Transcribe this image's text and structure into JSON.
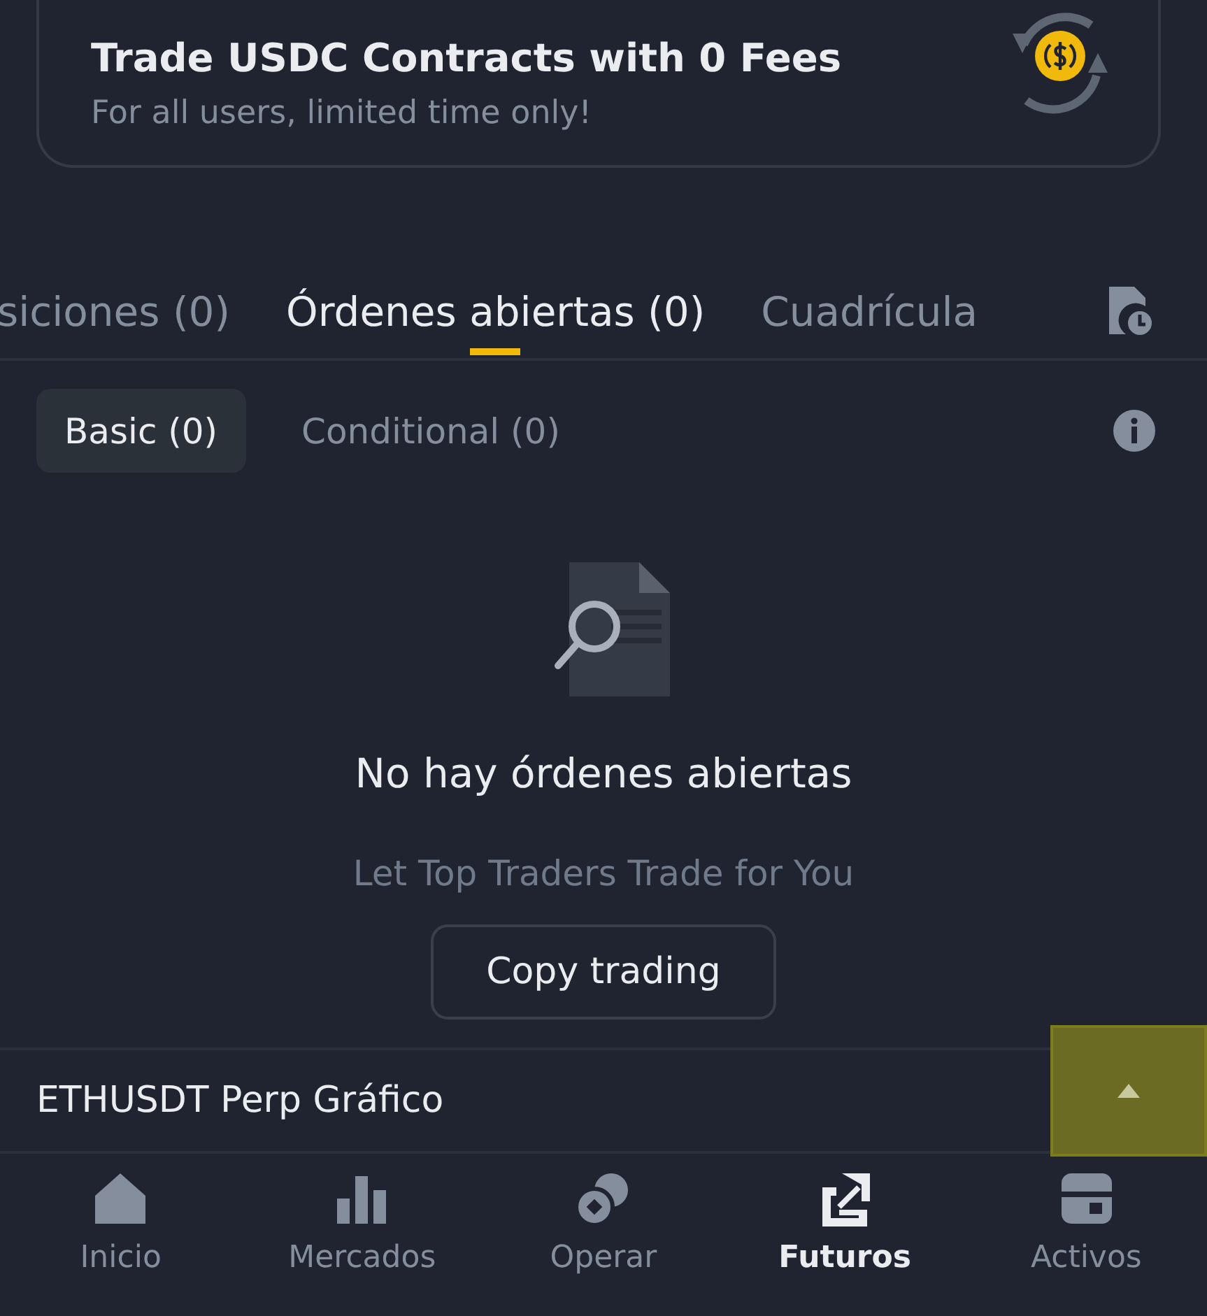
{
  "promo": {
    "title": "Trade USDC Contracts with 0 Fees",
    "subtitle": "For all users, limited time only!"
  },
  "tabs": [
    {
      "label": "siciones (0)",
      "selected": false
    },
    {
      "label": "Órdenes abiertas (0)",
      "selected": true
    },
    {
      "label": "Cuadrícula",
      "selected": false
    }
  ],
  "subtabs": [
    {
      "label": "Basic (0)",
      "selected": true
    },
    {
      "label": "Conditional (0)",
      "selected": false
    }
  ],
  "empty_state": {
    "title": "No hay órdenes abiertas",
    "hint": "Let Top Traders Trade for You",
    "button": "Copy trading"
  },
  "chart_bar": {
    "label": "ETHUSDT Perp Gráfico",
    "expanded": false,
    "highlighted": true
  },
  "nav": [
    {
      "label": "Inicio",
      "kind": "home",
      "selected": false
    },
    {
      "label": "Mercados",
      "kind": "markets",
      "selected": false
    },
    {
      "label": "Operar",
      "kind": "trade",
      "selected": false
    },
    {
      "label": "Futuros",
      "kind": "futures",
      "selected": true
    },
    {
      "label": "Activos",
      "kind": "assets",
      "selected": false
    }
  ]
}
